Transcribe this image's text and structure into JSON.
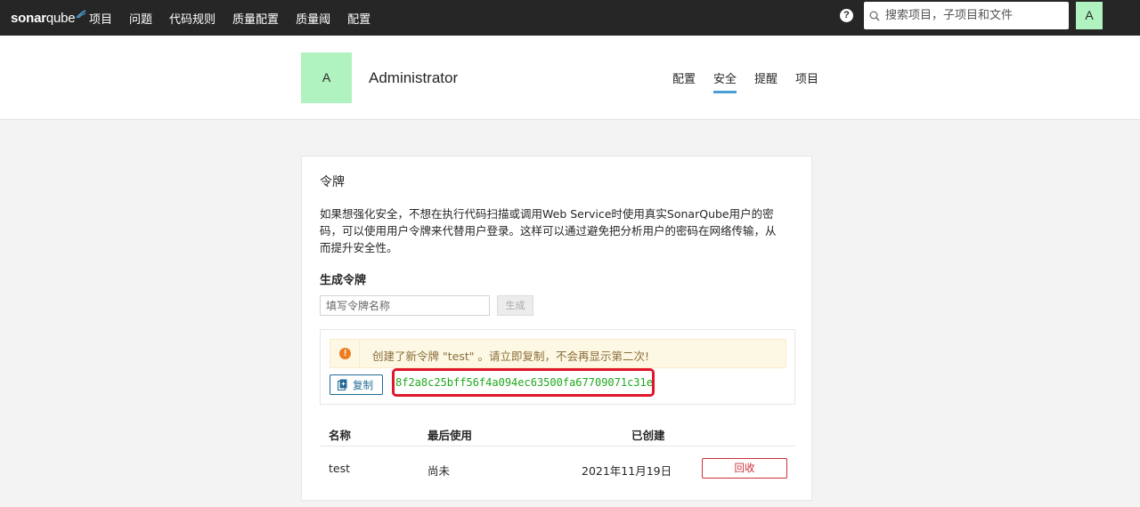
{
  "topbar": {
    "logo_text_a": "sonar",
    "logo_text_b": "qube",
    "nav": [
      "项目",
      "问题",
      "代码规则",
      "质量配置",
      "质量阈",
      "配置"
    ],
    "help_symbol": "?",
    "search_placeholder": "搜索项目，子项目和文件",
    "avatar_letter": "A"
  },
  "account": {
    "avatar_letter": "A",
    "name": "Administrator",
    "tabs": [
      "配置",
      "安全",
      "提醒",
      "项目"
    ],
    "active_tab": "安全"
  },
  "tokens": {
    "title": "令牌",
    "description": "如果想强化安全，不想在执行代码扫描或调用Web Service时使用真实SonarQube用户的密码，可以使用用户令牌来代替用户登录。这样可以通过避免把分析用户的密码在网络传输，从而提升安全性。",
    "generate_title": "生成令牌",
    "input_placeholder": "填写令牌名称",
    "generate_button": "生成",
    "warning_symbol": "!",
    "warning_text": "创建了新令牌 \"test\" 。请立即复制，不会再显示第二次!",
    "copy_button": "复制",
    "token_value": "8f2a8c25bff56f4a094ec63500fa67709071c31e",
    "table": {
      "headers": [
        "名称",
        "最后使用",
        "已创建"
      ],
      "rows": [
        {
          "name": "test",
          "last_used": "尚未",
          "created": "2021年11月19日",
          "action": "回收"
        }
      ]
    }
  },
  "colors": {
    "topbar_bg": "#262626",
    "avatar_bg": "#b0f2c0",
    "active_tab": "#4b9fd5",
    "token_green": "#1da91d",
    "highlight_red": "#e0162b",
    "revoke_red": "#d02f3a"
  }
}
